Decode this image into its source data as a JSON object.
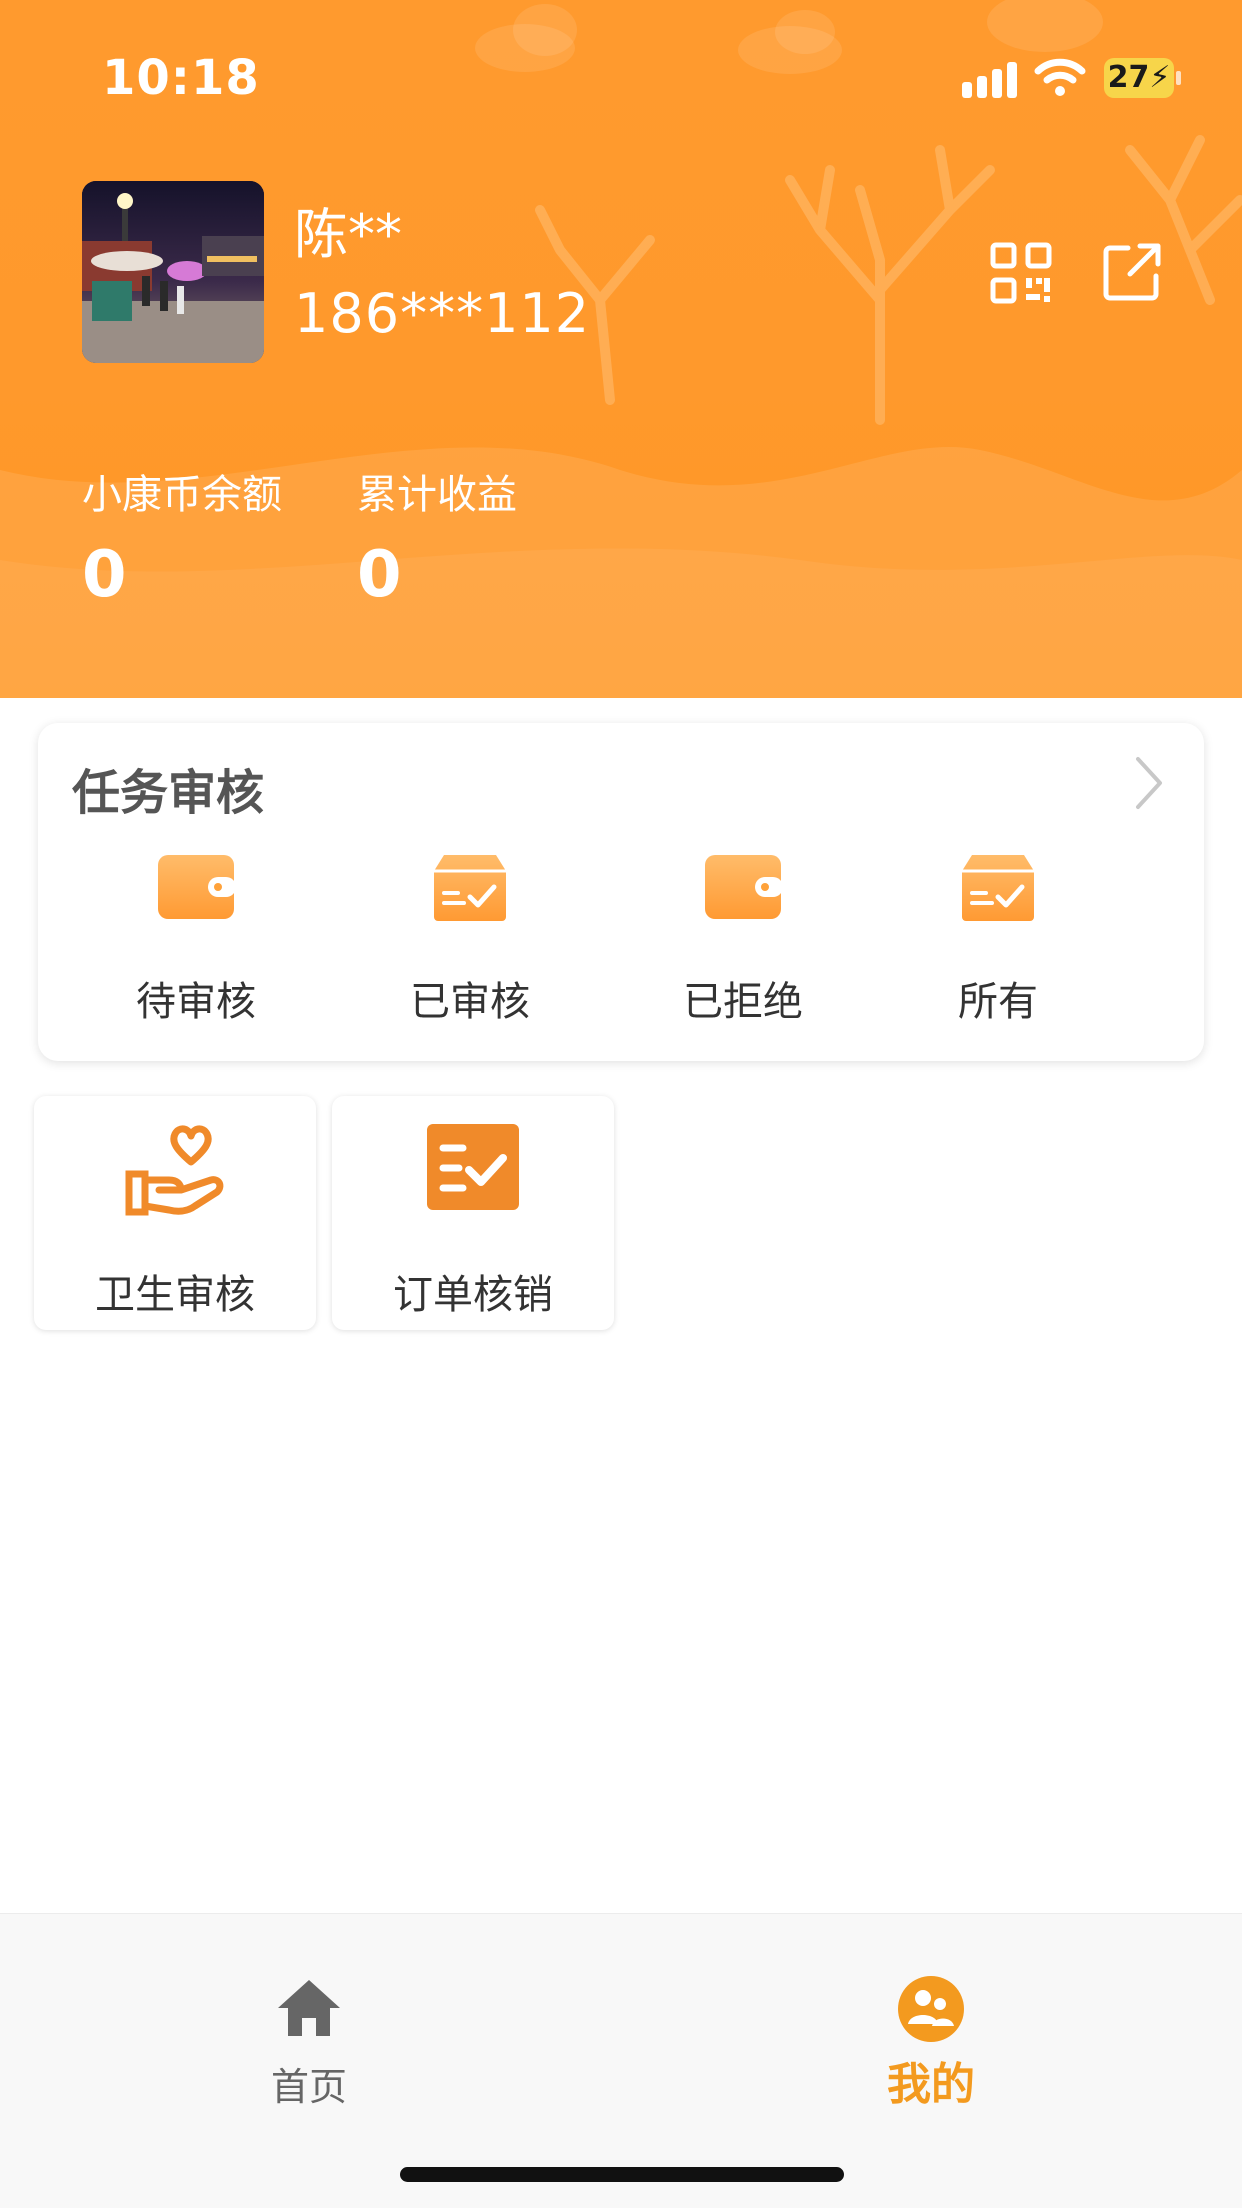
{
  "status_bar": {
    "time": "10:18",
    "battery": "27"
  },
  "profile": {
    "name": "陈**",
    "phone": "186***112",
    "avatar_icon": "night-street-photo"
  },
  "header_actions": {
    "qr_icon": "qr-code-icon",
    "share_icon": "external-link-icon"
  },
  "stats": [
    {
      "label": "小康币余额",
      "value": "0"
    },
    {
      "label": "累计收益",
      "value": "0"
    }
  ],
  "task_review": {
    "title": "任务审核",
    "items": [
      {
        "label": "待审核",
        "icon": "wallet-icon"
      },
      {
        "label": "已审核",
        "icon": "approved-box-icon"
      },
      {
        "label": "已拒绝",
        "icon": "wallet-icon"
      },
      {
        "label": "所有",
        "icon": "approved-box-icon"
      }
    ]
  },
  "tools": [
    {
      "label": "卫生审核",
      "icon": "hand-heart-icon"
    },
    {
      "label": "订单核销",
      "icon": "checklist-icon"
    }
  ],
  "tabbar": {
    "tabs": [
      {
        "label": "首页",
        "icon": "home-icon",
        "active": false
      },
      {
        "label": "我的",
        "icon": "user-group-icon",
        "active": true
      }
    ]
  },
  "colors": {
    "brand_orange": "#ff9a2e",
    "icon_orange": "#f08a2a",
    "tab_active": "#f39a1f",
    "tab_inactive": "#666666"
  }
}
